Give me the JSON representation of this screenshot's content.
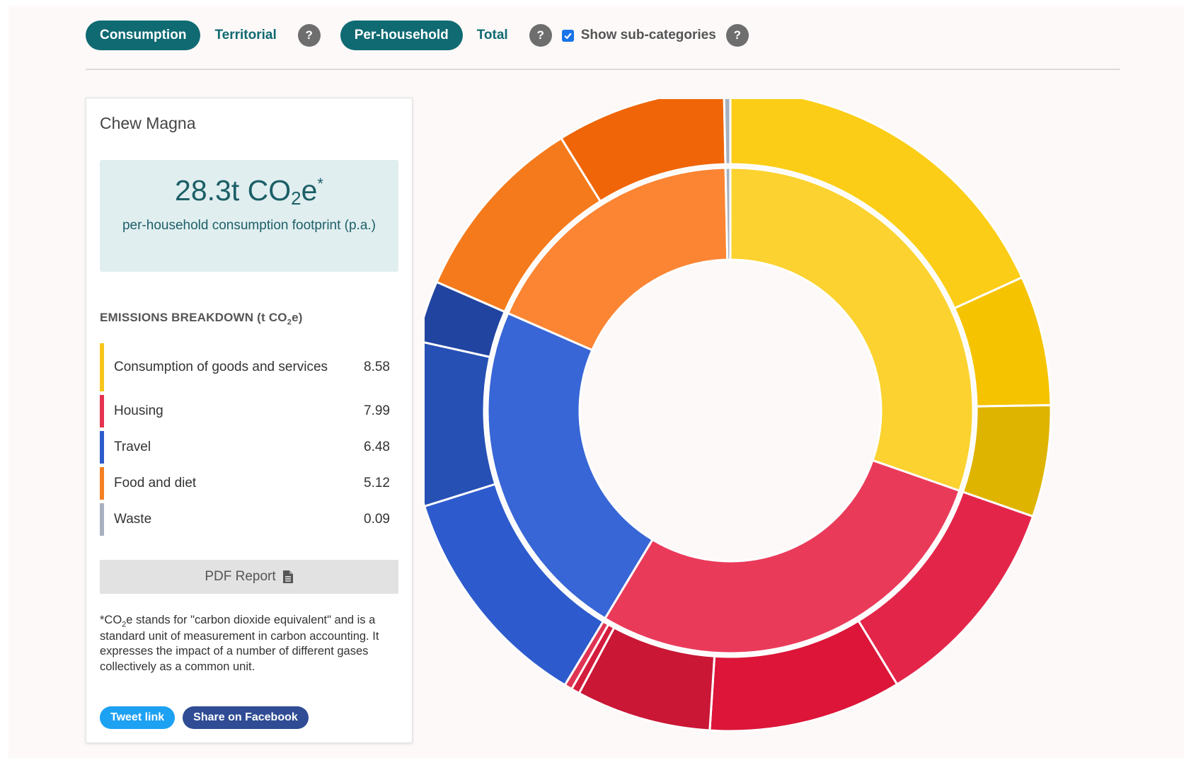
{
  "toolbar": {
    "consumption": "Consumption",
    "territorial": "Territorial",
    "per_household": "Per-household",
    "total": "Total",
    "help": "?",
    "subcategories": "Show sub-categories",
    "subcategories_checked": true
  },
  "card": {
    "place": "Chew Magna",
    "total_value": "28.3t CO",
    "total_sub": "2",
    "total_unit_tail": "e",
    "total_star": "*",
    "total_caption": "per-household consumption footprint (p.a.)",
    "breakdown_title_a": "EMISSIONS BREAKDOWN (t CO",
    "breakdown_title_sub": "2",
    "breakdown_title_b": "e)",
    "pdf_label": "PDF Report",
    "note_a": "*CO",
    "note_sub": "2",
    "note_b": "e stands for \"carbon dioxide equivalent\" and is a standard unit of measurement in carbon accounting. It expresses the impact of a number of different gases collectively as a common unit.",
    "tweet": "Tweet link",
    "facebook": "Share on Facebook"
  },
  "icons": {
    "pdf": "file-text-icon",
    "help": "question-icon",
    "check": "check-icon"
  },
  "chart_data": {
    "type": "pie",
    "style": "sunburst-donut",
    "units": "t CO2e",
    "start_angle_deg": 0,
    "categories": [
      {
        "name": "Consumption of goods and services",
        "value": 8.58,
        "color": "#f8c51c",
        "inner_color": "#fbd230",
        "sub": [
          {
            "value": 5.14,
            "color": "#fbcd17"
          },
          {
            "value": 1.85,
            "color": "#f5c300"
          },
          {
            "value": 1.59,
            "color": "#dfb400"
          }
        ]
      },
      {
        "name": "Housing",
        "value": 7.99,
        "color": "#e4334f",
        "inner_color": "#ea3a5a",
        "sub": [
          {
            "value": 3.09,
            "color": "#e4254a"
          },
          {
            "value": 2.75,
            "color": "#dc1539"
          },
          {
            "value": 1.92,
            "color": "#c91735"
          },
          {
            "value": 0.12,
            "color": "#d41c3c"
          },
          {
            "value": 0.11,
            "color": "#e03454"
          }
        ]
      },
      {
        "name": "Travel",
        "value": 6.48,
        "color": "#2f5ccc",
        "inner_color": "#3866d6",
        "sub": [
          {
            "value": 3.26,
            "color": "#2d5bcd"
          },
          {
            "value": 2.35,
            "color": "#2750b5"
          },
          {
            "value": 0.87,
            "color": "#2144a0"
          }
        ]
      },
      {
        "name": "Food and diet",
        "value": 5.12,
        "color": "#f48024",
        "inner_color": "#fb8533",
        "sub": [
          {
            "value": 2.71,
            "color": "#f57a1b"
          },
          {
            "value": 2.41,
            "color": "#ef6507"
          }
        ]
      },
      {
        "name": "Waste",
        "value": 0.09,
        "color": "#a7b1c0",
        "inner_color": "#a7b1c0",
        "sub": [
          {
            "value": 0.09,
            "color": "#a7b1c0"
          }
        ]
      }
    ]
  }
}
